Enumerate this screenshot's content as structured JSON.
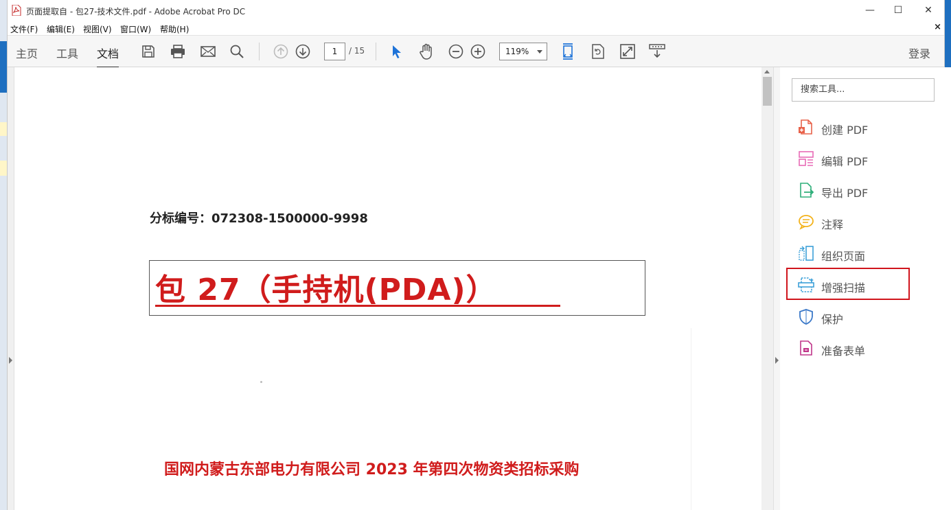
{
  "window": {
    "title": "页面提取自 - 包27-技术文件.pdf - Adobe Acrobat Pro DC"
  },
  "window_controls": {
    "minimize": "—",
    "maximize": "☐",
    "close": "✕"
  },
  "menu": [
    {
      "label": "文件(F)"
    },
    {
      "label": "编辑(E)"
    },
    {
      "label": "视图(V)"
    },
    {
      "label": "窗口(W)"
    },
    {
      "label": "帮助(H)"
    }
  ],
  "menu_close": "×",
  "nav_tabs": [
    {
      "label": "主页"
    },
    {
      "label": "工具"
    },
    {
      "label": "文档"
    }
  ],
  "toolbar": {
    "page_current": "1",
    "page_total": "/ 15",
    "zoom": "119%",
    "login": "登录"
  },
  "document": {
    "bid_number": "分标编号：072308-1500000-9998",
    "package_title": "包 27（手持机(PDA)）",
    "company_line": "国网内蒙古东部电力有限公司 2023 年第四次物资类招标采购"
  },
  "tools_pane": {
    "search_placeholder": "搜索工具...",
    "items": [
      {
        "label": "创建 PDF",
        "color": "#e8624a"
      },
      {
        "label": "编辑 PDF",
        "color": "#e86ab6"
      },
      {
        "label": "导出 PDF",
        "color": "#2faf7a"
      },
      {
        "label": "注释",
        "color": "#f3b21a"
      },
      {
        "label": "组织页面",
        "color": "#3ca0d8"
      },
      {
        "label": "增强扫描",
        "color": "#3ca0d8"
      },
      {
        "label": "保护",
        "color": "#3a78c8"
      },
      {
        "label": "准备表单",
        "color": "#c0368a"
      }
    ],
    "highlighted_item": "增强扫描"
  },
  "colors": {
    "accent_red": "#d01c1c",
    "highlight_border": "#d0141c",
    "select_blue": "#1e73d8"
  }
}
